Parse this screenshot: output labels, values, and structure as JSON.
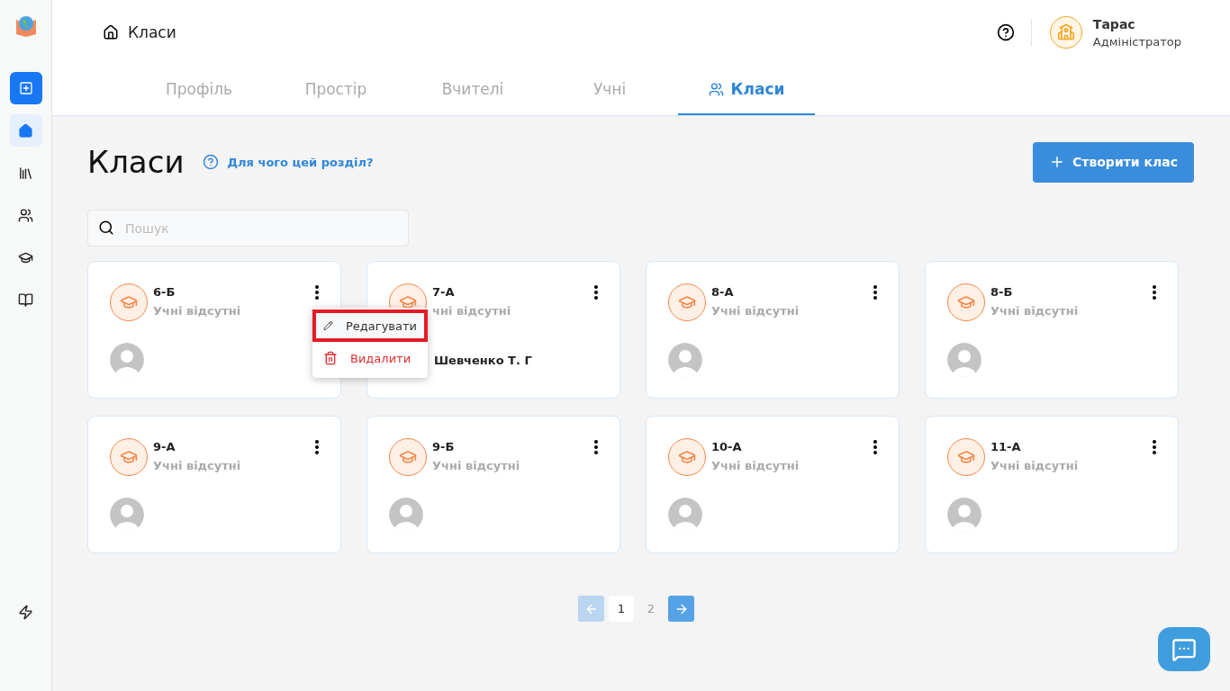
{
  "header": {
    "breadcrumb": "Класи",
    "user": {
      "name": "Тарас",
      "role": "Адміністратор"
    }
  },
  "tabs": [
    {
      "label": "Профіль",
      "selected": false
    },
    {
      "label": "Простір",
      "selected": false
    },
    {
      "label": "Вчителі",
      "selected": false
    },
    {
      "label": "Учні",
      "selected": false
    },
    {
      "label": "Класи",
      "selected": true
    }
  ],
  "page": {
    "title": "Класи",
    "help_link": "Для чого цей розділ?",
    "create_button": "Створити клас"
  },
  "search": {
    "placeholder": "Пошук"
  },
  "classes": [
    {
      "name": "6-Б",
      "subtitle": "Учні відсутні",
      "menu_open": true
    },
    {
      "name": "7-А",
      "subtitle": "чні відсутні",
      "teacher": "Шевченко Т. Г",
      "menu_open": false
    },
    {
      "name": "8-А",
      "subtitle": "Учні відсутні",
      "menu_open": false
    },
    {
      "name": "8-Б",
      "subtitle": "Учні відсутні",
      "menu_open": false
    },
    {
      "name": "9-А",
      "subtitle": "Учні відсутні",
      "menu_open": false
    },
    {
      "name": "9-Б",
      "subtitle": "Учні відсутні",
      "menu_open": false
    },
    {
      "name": "10-А",
      "subtitle": "Учні відсутні",
      "menu_open": false
    },
    {
      "name": "11-А",
      "subtitle": "Учні відсутні",
      "menu_open": false
    }
  ],
  "context_menu": [
    {
      "kind": "edit",
      "label": "Редагувати",
      "highlighted": true
    },
    {
      "kind": "delete",
      "label": "Видалити",
      "highlighted": false
    }
  ],
  "pagination": {
    "pages": [
      {
        "label": "1",
        "selected": true
      },
      {
        "label": "2",
        "selected": false
      }
    ],
    "prev_disabled": true,
    "next_disabled": false
  }
}
